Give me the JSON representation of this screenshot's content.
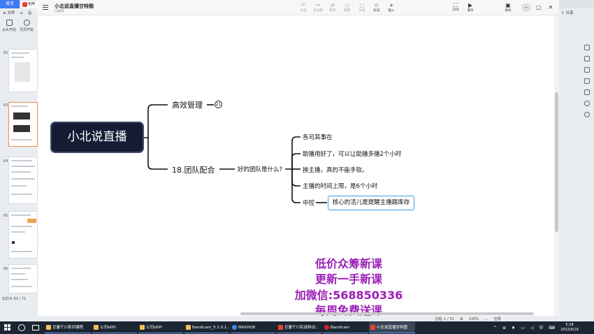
{
  "background_app": {
    "tab_home": "首页",
    "tab_doc": "稻壳",
    "menu": [
      "≡ 文件",
      "⌂",
      "⎙"
    ],
    "play_from_start": "从头开始",
    "play_current": "当页开始",
    "share": "分享",
    "status_left": "幻灯片 63 / 71",
    "status_right": [
      "注释 - 1 / 11",
      "150%",
      "+",
      "全屏"
    ]
  },
  "thumbnails": [
    {
      "num": "62"
    },
    {
      "num": "63"
    },
    {
      "num": "64"
    },
    {
      "num": "65"
    },
    {
      "num": "66"
    }
  ],
  "xmind": {
    "title": "小北说直播甘特图",
    "subtitle": "已编辑",
    "toolbar": [
      {
        "glyph": "↶",
        "label": "主题"
      },
      {
        "glyph": "↪",
        "label": "子主题"
      },
      {
        "glyph": "⇄",
        "label": "联系"
      },
      {
        "glyph": "▭",
        "label": "概要"
      },
      {
        "glyph": "▢",
        "label": "外框"
      },
      {
        "glyph": "☆",
        "label": "标记"
      },
      {
        "glyph": "+",
        "label": "插入"
      }
    ],
    "right_tools": [
      {
        "glyph": "⛶",
        "label": "ZEN"
      },
      {
        "glyph": "▶",
        "label": "演示"
      },
      {
        "glyph": "▣",
        "label": "格式"
      }
    ],
    "window_buttons": {
      "min": "–",
      "max": "▢",
      "close": "✕"
    },
    "status": [
      "主题: 1 / 31",
      "⊞",
      "150%",
      "⌄",
      "全屏"
    ]
  },
  "mindmap": {
    "root": "小北说直播",
    "branch1": "高效管理",
    "branch1_count": "21",
    "branch2": "18.团队配合",
    "sub_question": "好的团队是什么?",
    "items": [
      "各司其事在",
      "助播用好了，可以让助播多播2个小时",
      "换主播，真的不能手软。",
      "主播的时间上限，是6个小时",
      "中控"
    ],
    "highlight": "核心的活儿是提醒主播踢库存"
  },
  "promo": [
    "低价众筹新课",
    "更新一手新课",
    "加微信:568850336",
    "每周免费送课"
  ],
  "taskbar": {
    "tasks": [
      {
        "label": "巨量千川系列课程",
        "color": "#f2c14e"
      },
      {
        "label": "公司kKPI",
        "color": "#f2c14e"
      },
      {
        "label": "公司kKPI",
        "color": "#f2c14e"
      },
      {
        "label": "Bandicam_5.1.0.1...",
        "color": "#f2c14e"
      },
      {
        "label": "MAXHUB",
        "color": "#3e8be8"
      },
      {
        "label": "巨量千川实战特训...",
        "color": "#e5462f"
      },
      {
        "label": "Bandicam",
        "color": "#d2232a"
      },
      {
        "label": "小北说直播甘特图",
        "color": "#e5462f"
      }
    ],
    "tray": [
      "^",
      "⊕",
      "♦",
      "▭",
      "◁",
      "中",
      "⌨"
    ],
    "time": "5:18",
    "date": "2022/6/19"
  }
}
